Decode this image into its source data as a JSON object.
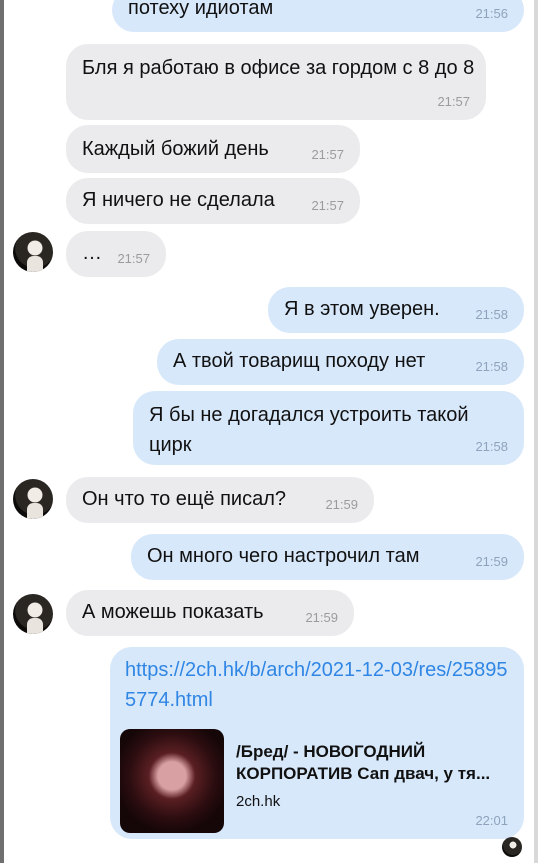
{
  "messages": [
    {
      "text": "потеху идиотам",
      "time": "21:56"
    },
    {
      "text": "Бля я работаю в офисе за гордом с 8 до 8",
      "time": "21:57"
    },
    {
      "text": "Каждый божий день",
      "time": "21:57"
    },
    {
      "text": "Я ничего не сделала",
      "time": "21:57"
    },
    {
      "text": "…",
      "time": "21:57"
    },
    {
      "text": "Я в этом уверен.",
      "time": "21:58"
    },
    {
      "text": "А твой товарищ походу нет",
      "time": "21:58"
    },
    {
      "text": "Я бы не догадался устроить такой цирк",
      "time": "21:58"
    },
    {
      "text": "Он что то ещё писал?",
      "time": "21:59"
    },
    {
      "text": "Он много чего настрочил там",
      "time": "21:59"
    },
    {
      "text": "А можешь показать",
      "time": "21:59"
    },
    {
      "link": "https://2ch.hk/b/arch/2021-12-03/res/258955774.html",
      "preview_title": "/Бред/ - НОВОГОДНИЙ КОРПОРАТИВ Сап двач, у тя...",
      "preview_site": "2ch.hk",
      "time": "22:01"
    }
  ],
  "colors": {
    "incoming_bubble": "#ebebed",
    "outgoing_bubble": "#d8e8fb",
    "link": "#2f86e4",
    "timestamp": "#9a9ba0"
  }
}
